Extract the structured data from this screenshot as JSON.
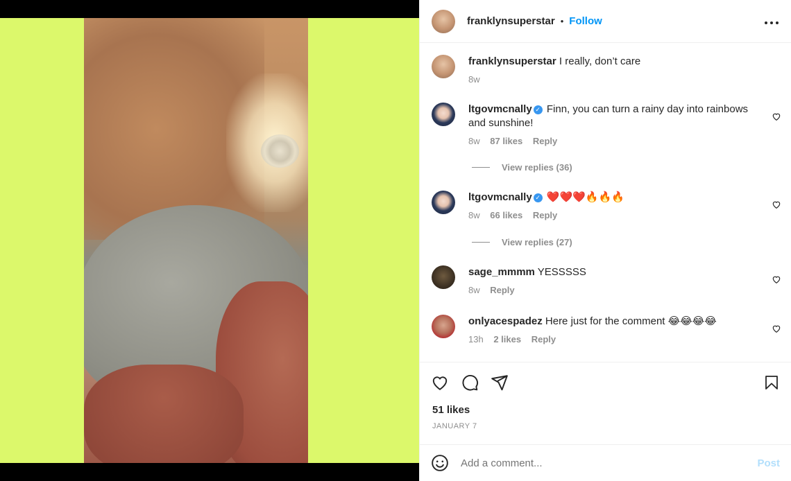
{
  "post": {
    "author": "franklynsuperstar",
    "separator": "•",
    "follow_label": "Follow",
    "more_label": "•••",
    "caption_text": "I really, don’t care",
    "caption_time": "8w"
  },
  "comments": [
    {
      "user": "ltgovmcnally",
      "verified": true,
      "text": "Finn, you can turn a rainy day into rainbows and sunshine!",
      "time": "8w",
      "likes": "87 likes",
      "reply": "Reply",
      "view_replies": "View replies (36)"
    },
    {
      "user": "ltgovmcnally",
      "verified": true,
      "text": "❤️❤️❤️🔥🔥🔥",
      "time": "8w",
      "likes": "66 likes",
      "reply": "Reply",
      "view_replies": "View replies (27)"
    },
    {
      "user": "sage_mmmm",
      "verified": false,
      "text": "YESSSSS",
      "time": "8w",
      "reply": "Reply"
    },
    {
      "user": "onlyacespadez",
      "verified": false,
      "text": "Here just for the comment 😂😂😂😂",
      "time": "13h",
      "likes": "2 likes",
      "reply": "Reply"
    }
  ],
  "stats": {
    "likes": "51 likes",
    "date": "JANUARY 7"
  },
  "add_comment": {
    "placeholder": "Add a comment...",
    "post_label": "Post"
  },
  "icons": {
    "like": "heart-icon",
    "comment": "comment-icon",
    "share": "send-icon",
    "save": "bookmark-icon",
    "emoji": "emoji-icon",
    "verified": "verified-badge-icon"
  },
  "colors": {
    "link_blue": "#0095f6",
    "post_disabled": "#b2dffc",
    "media_bg": "#dcf86b",
    "muted": "#8e8e8e"
  }
}
